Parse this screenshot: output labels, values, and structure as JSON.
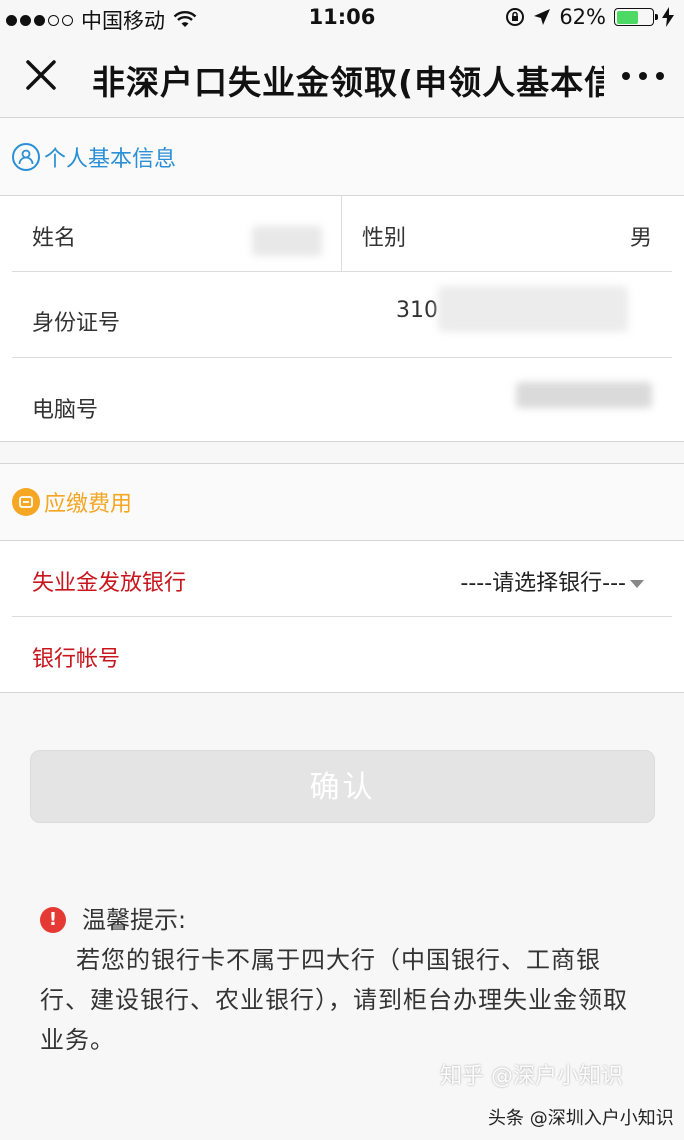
{
  "status_bar": {
    "carrier": "中国移动",
    "time": "11:06",
    "battery": "62%",
    "battery_level": 0.62
  },
  "nav": {
    "title": "非深户口失业金领取(申领人基本信"
  },
  "personal_section": {
    "title": "个人基本信息",
    "name_label": "姓名",
    "gender_label": "性别",
    "gender_value": "男",
    "id_label": "身份证号",
    "id_value_prefix": "310",
    "computer_no_label": "电脑号"
  },
  "fee_section": {
    "title": "应缴费用",
    "bank_label": "失业金发放银行",
    "bank_select": "----请选择银行---",
    "account_label": "银行帐号"
  },
  "confirm_button": "确认",
  "tip": {
    "title": "温馨提示:",
    "body": "若您的银行卡不属于四大行（中国银行、工商银行、建设银行、农业银行），请到柜台办理失业金领取业务。"
  },
  "watermarks": {
    "zhihu": "知乎 @深户小知识",
    "toutiao": "头条 @深圳入户小知识"
  },
  "colors": {
    "accent_blue": "#2a8fd6",
    "required_red": "#c8161d",
    "section_orange": "#f5a623"
  }
}
